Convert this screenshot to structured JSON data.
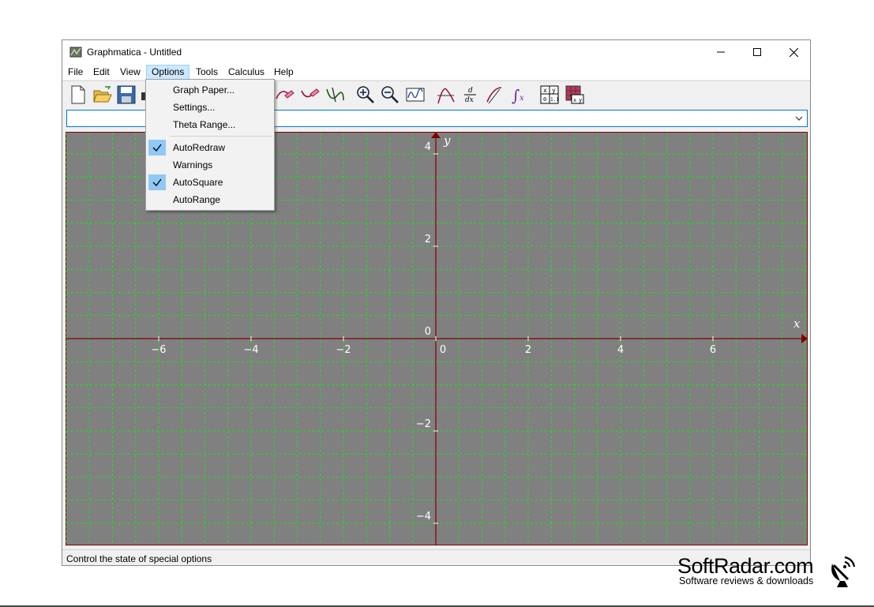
{
  "window": {
    "title": "Graphmatica - Untitled"
  },
  "menu": [
    "File",
    "Edit",
    "View",
    "Options",
    "Tools",
    "Calculus",
    "Help"
  ],
  "active_menu": "Options",
  "options_menu": {
    "items": [
      {
        "label": "Graph Paper...",
        "checked": false
      },
      {
        "label": "Settings...",
        "checked": false
      },
      {
        "label": "Theta Range...",
        "checked": false
      },
      {
        "label": "AutoRedraw",
        "checked": true
      },
      {
        "label": "Warnings",
        "checked": false
      },
      {
        "label": "AutoSquare",
        "checked": true
      },
      {
        "label": "AutoRange",
        "checked": false
      }
    ]
  },
  "equation_input": {
    "value": ""
  },
  "graph": {
    "x_axis_label": "x",
    "y_axis_label": "y",
    "x_ticks": [
      "−6",
      "−4",
      "−2",
      "0",
      "2",
      "4",
      "6"
    ],
    "y_ticks": [
      "4",
      "2",
      "0",
      "−2",
      "−4"
    ],
    "xlim": [
      -8,
      8
    ],
    "ylim": [
      -4.5,
      4.5
    ],
    "grid": true,
    "colors": {
      "background": "#808080",
      "grid": "#00ff00",
      "axes": "#800000",
      "labels": "#ffffff"
    }
  },
  "toolbar": {
    "icons": [
      "new-file-icon",
      "open-folder-icon",
      "save-icon",
      "print-icon",
      "erase-icon",
      "erase-curve-icon",
      "erase-all-icon",
      "trace-icon",
      "zoom-in-icon",
      "zoom-out-icon",
      "zoom-fit-icon",
      "tangent-icon",
      "derivative-icon",
      "tangent-line-icon",
      "integral-icon",
      "table-icon",
      "data-grid-icon"
    ],
    "derivative_label": "d/dx",
    "table_header": "x y",
    "table_row": "0 1.1"
  },
  "status": {
    "text": "Control the state of special options"
  },
  "watermark": {
    "title": "SoftRadar.com",
    "subtitle": "Software reviews & downloads"
  }
}
